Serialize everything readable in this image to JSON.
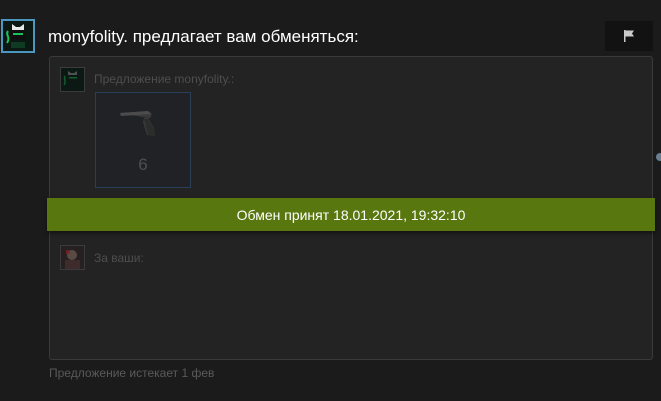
{
  "header": {
    "title": "monyfolity. предлагает вам обменяться:",
    "report_icon": "flag-icon"
  },
  "offer": {
    "partner_label": "Предложение monyfolity.:",
    "item": {
      "icon": "pistol-icon",
      "count": "6"
    },
    "status": "Обмен принят 18.01.2021, 19:32:10",
    "yours_label": "За ваши:"
  },
  "footer": {
    "expires": "Предложение истекает 1 фев"
  },
  "colors": {
    "background": "#1b1b1b",
    "panel": "#232323",
    "status_banner": "#59770f",
    "avatar_border": "#4c97c0",
    "item_border": "#2a3f57"
  }
}
